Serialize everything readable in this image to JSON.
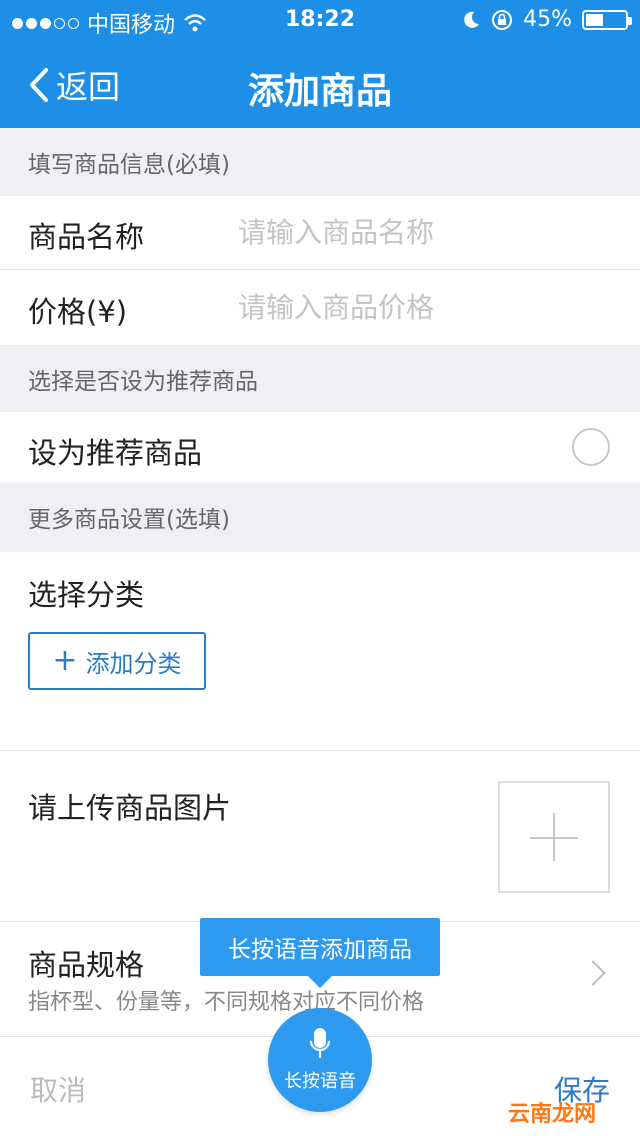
{
  "status_bar": {
    "carrier": "中国移动",
    "time": "18:22",
    "battery": "45%",
    "battery_level": 0.45,
    "icons": [
      "signal-dots",
      "wifi-icon",
      "moon-icon",
      "rotation-lock-icon",
      "battery-icon"
    ]
  },
  "nav": {
    "back_label": "返回",
    "title": "添加商品"
  },
  "sections": {
    "required_header": "填写商品信息(必填)",
    "recommend_header": "选择是否设为推荐商品",
    "optional_header": "更多商品设置(选填)"
  },
  "fields": {
    "name_label": "商品名称",
    "name_placeholder": "请输入商品名称",
    "name_value": "",
    "price_label": "价格(¥)",
    "price_placeholder": "请输入商品价格",
    "price_value": ""
  },
  "recommend": {
    "label": "设为推荐商品",
    "checked": false
  },
  "category": {
    "label": "选择分类",
    "add_button": "添加分类"
  },
  "image": {
    "label": "请上传商品图片"
  },
  "spec": {
    "label": "商品规格",
    "subtitle": "指杯型、份量等，不同规格对应不同价格"
  },
  "tooltip": {
    "text": "长按语音添加商品"
  },
  "bottom_bar": {
    "cancel": "取消",
    "save": "保存",
    "voice": "长按语音"
  },
  "watermark": "云南龙网",
  "colors": {
    "primary": "#1e8fe6",
    "accent": "#2a7cc7",
    "background": "#efeff4"
  }
}
